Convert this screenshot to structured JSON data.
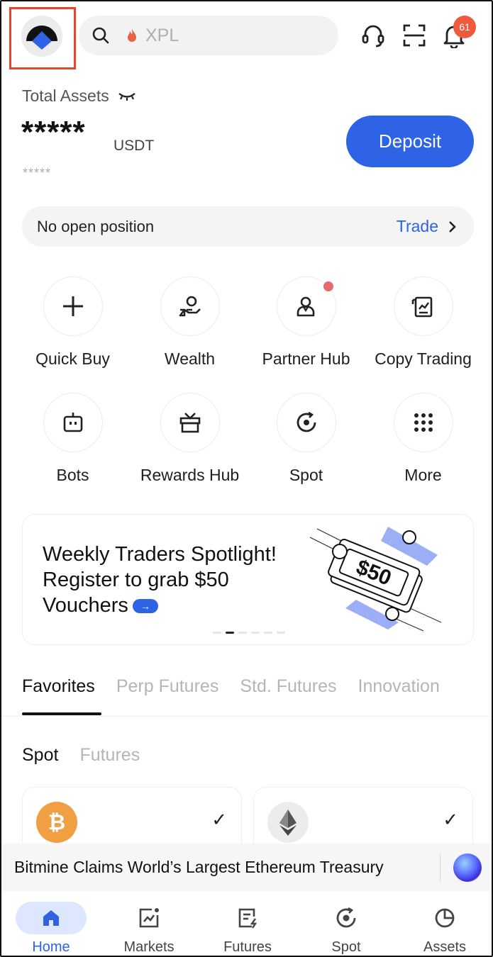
{
  "header": {
    "search_placeholder": "XPL",
    "notification_count": "61"
  },
  "assets": {
    "label": "Total Assets",
    "balance_masked": "*****",
    "currency": "USDT",
    "sub_masked": "*****",
    "deposit_label": "Deposit"
  },
  "position": {
    "text": "No open position",
    "trade_label": "Trade"
  },
  "quick_actions": [
    {
      "label": "Quick Buy",
      "icon": "plus-icon"
    },
    {
      "label": "Wealth",
      "icon": "wealth-hand-icon"
    },
    {
      "label": "Partner Hub",
      "icon": "partner-icon"
    },
    {
      "label": "Copy Trading",
      "icon": "copy-trading-icon"
    },
    {
      "label": "Bots",
      "icon": "bot-icon"
    },
    {
      "label": "Rewards Hub",
      "icon": "gift-icon"
    },
    {
      "label": "Spot",
      "icon": "spot-icon"
    },
    {
      "label": "More",
      "icon": "grid-icon"
    }
  ],
  "banner": {
    "text": "Weekly Traders Spotlight! Register to grab $50 Vouchers",
    "voucher_amount": "$50"
  },
  "market_tabs": [
    "Favorites",
    "Perp Futures",
    "Std. Futures",
    "Innovation"
  ],
  "sub_tabs": [
    "Spot",
    "Futures"
  ],
  "ticker": {
    "headline": "Bitmine Claims World’s Largest Ethereum Treasury"
  },
  "nav": [
    {
      "label": "Home",
      "icon": "home-icon"
    },
    {
      "label": "Markets",
      "icon": "markets-icon"
    },
    {
      "label": "Futures",
      "icon": "futures-icon"
    },
    {
      "label": "Spot",
      "icon": "spot-icon"
    },
    {
      "label": "Assets",
      "icon": "assets-pie-icon"
    }
  ],
  "colors": {
    "accent": "#2e63e6",
    "badge": "#ef5a3c",
    "highlight_box": "#e8452c"
  }
}
